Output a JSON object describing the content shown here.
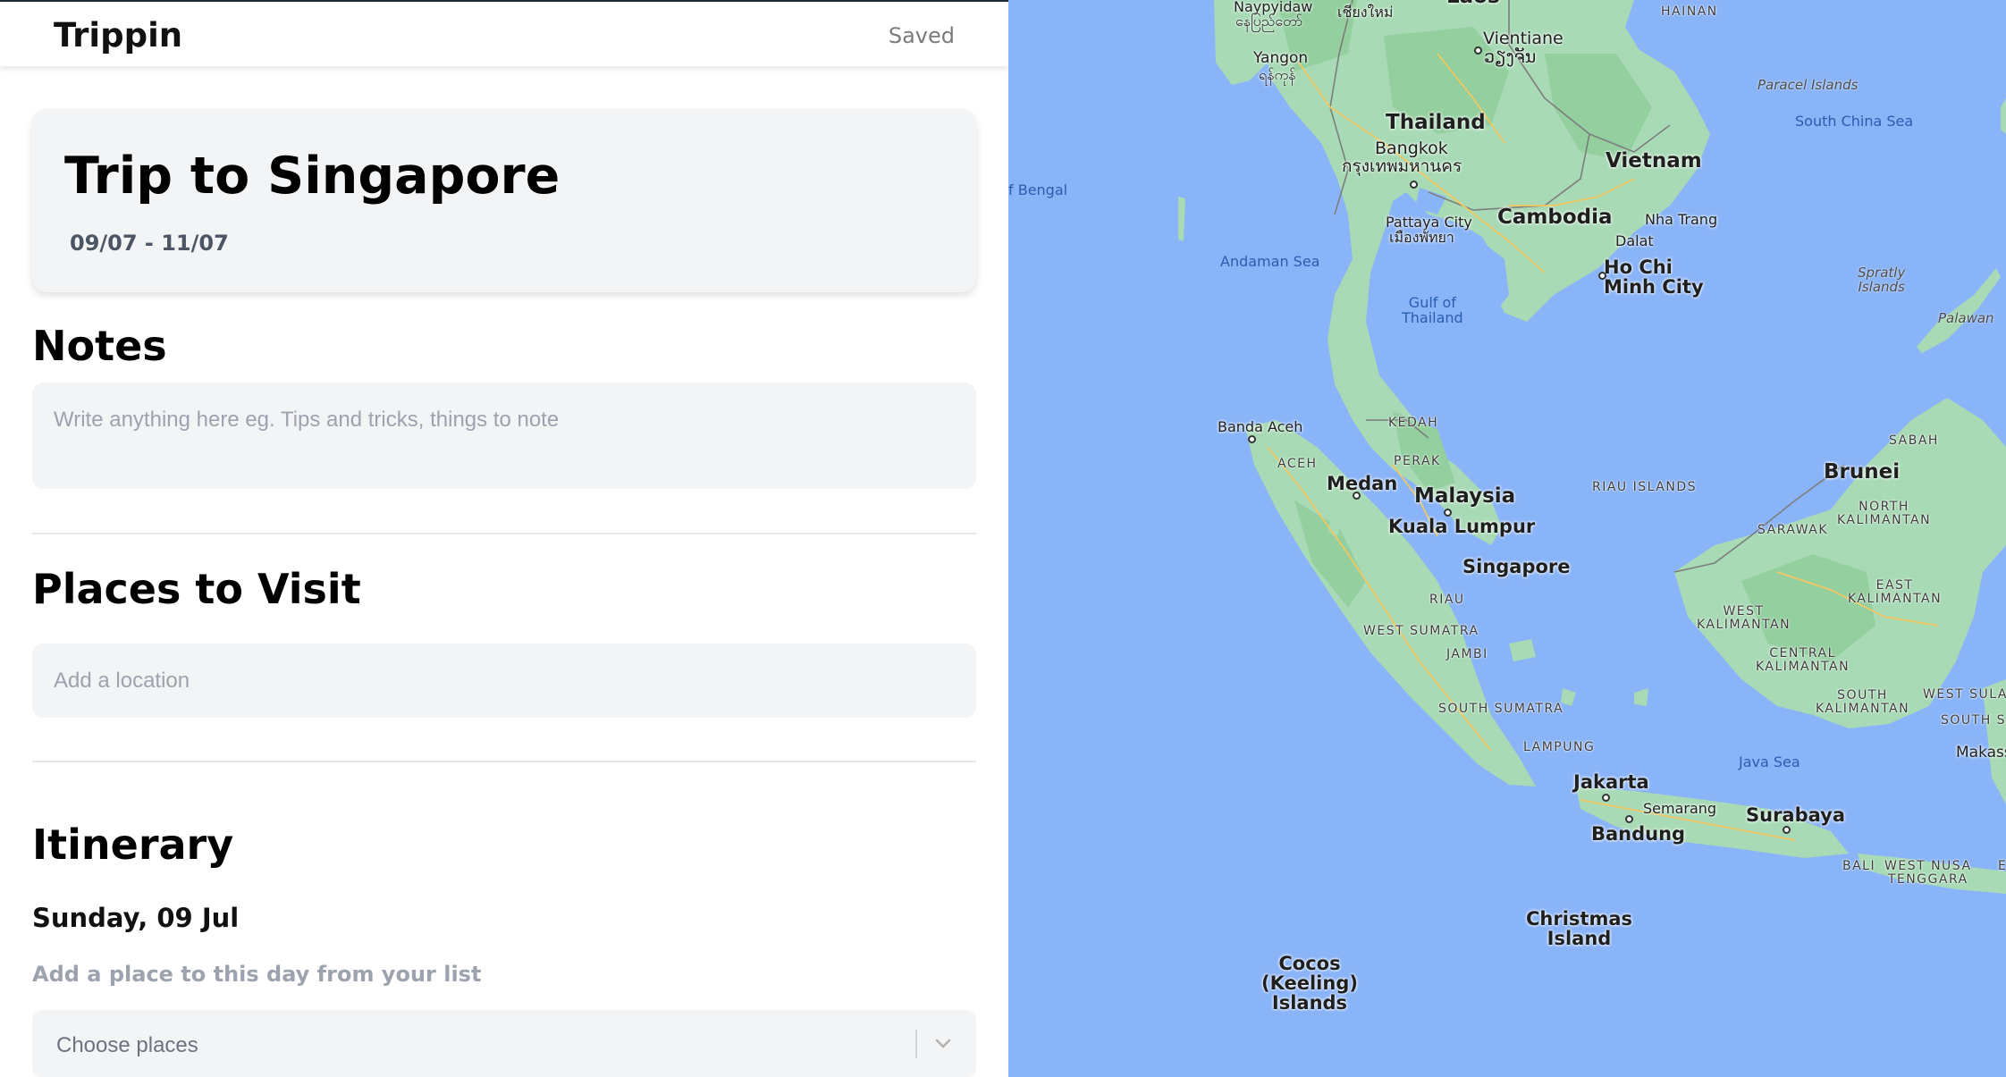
{
  "app": {
    "brand": "Trippin",
    "save_status": "Saved"
  },
  "trip": {
    "title": "Trip to Singapore",
    "dates": "09/07 - 11/07"
  },
  "notes": {
    "heading": "Notes",
    "placeholder": "Write anything here eg. Tips and tricks, things to note"
  },
  "places": {
    "heading": "Places to Visit",
    "placeholder": "Add a location"
  },
  "itinerary": {
    "heading": "Itinerary",
    "days": [
      {
        "title": "Sunday, 09 Jul",
        "hint": "Add a place to this day from your list",
        "select_placeholder": "Choose places"
      }
    ]
  },
  "map": {
    "countries": [
      "Thailand",
      "Vietnam",
      "Cambodia",
      "Malaysia",
      "Brunei"
    ],
    "cities": {
      "naypyidaw": "Naypyidaw",
      "naypyidaw_local": "နေပြည်တော်",
      "chiangmai_local": "เชียงใหม่",
      "laos": "Laos",
      "vientiane": "Vientiane",
      "vientiane_local": "ວຽງຈັນ",
      "yangon": "Yangon",
      "yangon_local": "ရန်ကုန်",
      "bangkok": "Bangkok",
      "bangkok_local": "กรุงเทพมหานคร",
      "pattaya": "Pattaya City",
      "pattaya_local": "เมืองพัทยา",
      "nhatrang": "Nha Trang",
      "dalat": "Dalat",
      "hcmc": "Ho Chi\nMinh City",
      "banda_aceh": "Banda Aceh",
      "medan": "Medan",
      "kuala_lumpur": "Kuala Lumpur",
      "singapore": "Singapore",
      "jakarta": "Jakarta",
      "semarang": "Semarang",
      "bandung": "Bandung",
      "surabaya": "Surabaya",
      "makassar": "Makass"
    },
    "regions": {
      "hainan": "HAINAN",
      "kedah": "KEDAH",
      "perak": "PERAK",
      "aceh": "ACEH",
      "riau_islands": "RIAU ISLANDS",
      "riau": "RIAU",
      "west_sumatra": "WEST SUMATRA",
      "jambi": "JAMBI",
      "south_sumatra": "SOUTH SUMATRA",
      "lampung": "LAMPUNG",
      "sabah": "SABAH",
      "sarawak": "SARAWAK",
      "north_kalimantan": "NORTH\nKALIMANTAN",
      "east_kalimantan": "EAST\nKALIMANTAN",
      "west_kalimantan": "WEST\nKALIMANTAN",
      "central_kalimantan": "CENTRAL\nKALIMANTAN",
      "south_kalimantan": "SOUTH\nKALIMANTAN",
      "west_sula": "WEST SULA",
      "south_s": "SOUTH S",
      "bali": "BALI",
      "west_nusa": "WEST NUSA\nTENGGARA",
      "edge_e": "E"
    },
    "waters": {
      "bengal": "f Bengal",
      "andaman": "Andaman Sea",
      "gulf": "Gulf of\nThailand",
      "scs": "South\nChina Sea",
      "java": "Java Sea"
    },
    "islands": {
      "paracel": "Paracel\nIslands",
      "spratly": "Spratly\nIslands",
      "palawan": "Palawan",
      "christmas": "Christmas\nIsland",
      "cocos": "Cocos\n(Keeling)\nIslands"
    }
  }
}
